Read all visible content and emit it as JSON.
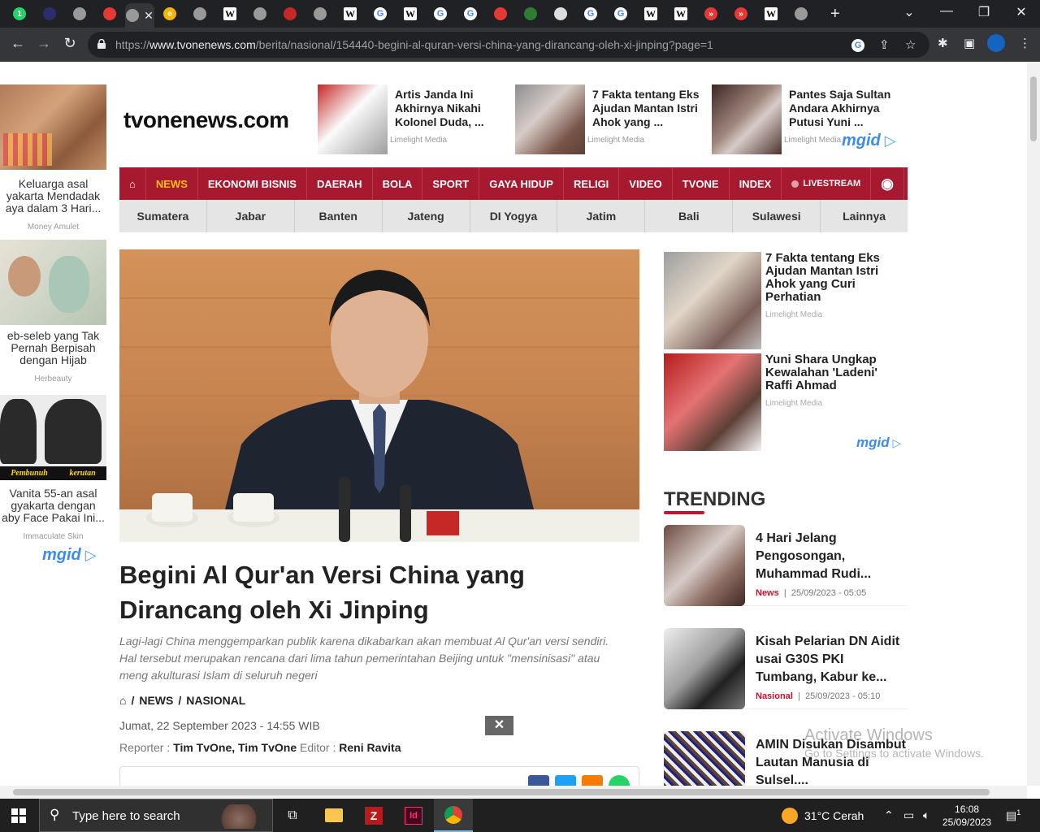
{
  "browser": {
    "tabs": [
      {
        "icon": "whatsapp-icon",
        "glyph": "1",
        "color": "#25d366"
      },
      {
        "icon": "tab-circle-icon",
        "glyph": "",
        "color": "#2d2d6b"
      },
      {
        "icon": "chrome-icon",
        "glyph": "",
        "color": "#999"
      },
      {
        "icon": "cnbc-icon",
        "glyph": "",
        "color": "#e53935"
      },
      {
        "icon": "active-tab-icon",
        "glyph": "",
        "color": "#999"
      },
      {
        "icon": "edge-icon",
        "glyph": "e",
        "color": "#f4b400"
      },
      {
        "icon": "chrome-icon",
        "glyph": "",
        "color": "#999"
      },
      {
        "icon": "wikipedia-icon",
        "glyph": "W",
        "color": "#fff"
      },
      {
        "icon": "chrome-icon",
        "glyph": "",
        "color": "#999"
      },
      {
        "icon": "red-dot-icon",
        "glyph": "",
        "color": "#c62828"
      },
      {
        "icon": "chrome-icon",
        "glyph": "",
        "color": "#999"
      },
      {
        "icon": "wikipedia-icon",
        "glyph": "W",
        "color": "#fff"
      },
      {
        "icon": "google-icon",
        "glyph": "G",
        "color": "#fff"
      },
      {
        "icon": "wikipedia-icon",
        "glyph": "W",
        "color": "#fff"
      },
      {
        "icon": "google-icon",
        "glyph": "G",
        "color": "#fff"
      },
      {
        "icon": "google-icon",
        "glyph": "G",
        "color": "#fff"
      },
      {
        "icon": "cnbc-icon",
        "glyph": "",
        "color": "#e53935"
      },
      {
        "icon": "kemenag-icon",
        "glyph": "",
        "color": "#2e7d32"
      },
      {
        "icon": "image-icon",
        "glyph": "",
        "color": "#ddd"
      },
      {
        "icon": "google-icon",
        "glyph": "G",
        "color": "#fff"
      },
      {
        "icon": "google-icon",
        "glyph": "G",
        "color": "#fff"
      },
      {
        "icon": "wikipedia-icon",
        "glyph": "W",
        "color": "#fff"
      },
      {
        "icon": "wikipedia-icon",
        "glyph": "W",
        "color": "#fff"
      },
      {
        "icon": "arrow-red-icon",
        "glyph": "»",
        "color": "#e53935"
      },
      {
        "icon": "arrow-red-icon",
        "glyph": "»",
        "color": "#e53935"
      },
      {
        "icon": "wikipedia-icon",
        "glyph": "W",
        "color": "#fff"
      },
      {
        "icon": "chrome-icon",
        "glyph": "",
        "color": "#999"
      }
    ],
    "url_scheme": "https://",
    "url_host": "www.tvonenews.com",
    "url_path": "/berita/nasional/154440-begini-al-quran-versi-china-yang-dirancang-oleh-xi-jinping?page=1"
  },
  "left_ads": [
    {
      "title": "Keluarga asal\nyakarta Mendadak\naya dalam 3 Hari...",
      "source": "Money Amulet"
    },
    {
      "title": "eb-seleb yang Tak\nPernah Berpisah\ndengan Hijab",
      "source": "Herbeauty"
    },
    {
      "title": "Vanita 55-an asal\ngyakarta dengan\naby Face Pakai Ini...",
      "source": "Immaculate Skin",
      "overlay_1": "Pembunuh",
      "overlay_2": "kerutan"
    }
  ],
  "mgid_label": "mgid",
  "logo": "tvonenews.com",
  "header_ads": [
    {
      "title": "Artis Janda Ini Akhirnya Nikahi Kolonel Duda, ...",
      "source": "Limelight Media"
    },
    {
      "title": "7 Fakta tentang Eks Ajudan Mantan Istri Ahok yang ...",
      "source": "Limelight Media"
    },
    {
      "title": "Pantes Saja Sultan Andara Akhirnya Putusi Yuni ...",
      "source": "Limelight Media"
    }
  ],
  "nav": {
    "items": [
      "NEWS",
      "EKONOMI BISNIS",
      "DAERAH",
      "BOLA",
      "SPORT",
      "GAYA HIDUP",
      "RELIGI",
      "VIDEO",
      "TVONE",
      "INDEX"
    ],
    "livestream": "LIVESTREAM"
  },
  "subnav": [
    "Sumatera",
    "Jabar",
    "Banten",
    "Jateng",
    "DI Yogya",
    "Jatim",
    "Bali",
    "Sulawesi",
    "Lainnya"
  ],
  "article": {
    "headline": "Begini Al Qur'an Versi China yang Dirancang oleh Xi Jinping",
    "lead": "Lagi-lagi China menggemparkan publik karena dikabarkan akan membuat Al Qur'an versi sendiri. Hal tersebut merupakan rencana dari lima tahun pemerintahan Beijing untuk \"mensinisasi\" atau meng akulturasi Islam di seluruh negeri",
    "crumb_1": "NEWS",
    "crumb_2": "NASIONAL",
    "crumb_sep": "/",
    "date": "Jumat, 22 September 2023 - 14:55 WIB",
    "reporter_label": "Reporter :",
    "reporter": "Tim TvOne, Tim TvOne",
    "editor_label": "Editor :",
    "editor": "Reni Ravita",
    "close_glyph": "✕"
  },
  "right_ads": [
    {
      "title": "7 Fakta tentang Eks Ajudan Mantan Istri Ahok yang Curi Perhatian",
      "source": "Limelight Media"
    },
    {
      "title": "Yuni Shara Ungkap Kewalahan 'Ladeni' Raffi Ahmad",
      "source": "Limelight Media"
    }
  ],
  "trending": {
    "title": "TRENDING",
    "items": [
      {
        "title": "4 Hari Jelang Pengosongan, Muhammad Rudi...",
        "category": "News",
        "date": "25/09/2023 - 05:05"
      },
      {
        "title": "Kisah Pelarian DN Aidit usai G30S PKI Tumbang, Kabur ke...",
        "category": "Nasional",
        "date": "25/09/2023 - 05:10"
      },
      {
        "title": "AMIN Disukan Disambut Lautan Manusia di Sulsel....",
        "category": "",
        "date": ""
      }
    ]
  },
  "watermark": {
    "line1": "Activate Windows",
    "line2": "Go to Settings to activate Windows."
  },
  "taskbar": {
    "search_placeholder": "Type here to search",
    "weather": "31°C  Cerah",
    "time": "16:08",
    "date": "25/09/2023",
    "notif_count": "1"
  },
  "colors": {
    "brand_red": "#a6192e",
    "nav_active": "#ffc107",
    "trending_red": "#c8102e",
    "mgid_blue": "#3b8ded"
  }
}
